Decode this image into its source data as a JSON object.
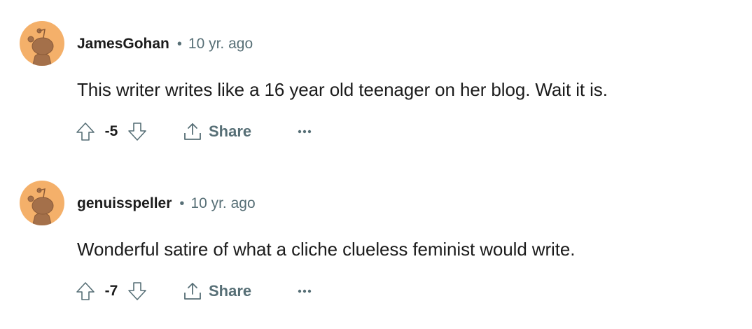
{
  "comments": [
    {
      "author": "JamesGohan",
      "separator": "•",
      "time": "10 yr. ago",
      "text": "This writer writes like a 16 year old teenager on her blog. Wait it is.",
      "score": "-5",
      "share_label": "Share",
      "more_label": "..."
    },
    {
      "author": "genuisspeller",
      "separator": "•",
      "time": "10 yr. ago",
      "text": "Wonderful satire of what a cliche clueless feminist would write.",
      "score": "-7",
      "share_label": "Share",
      "more_label": "..."
    }
  ],
  "colors": {
    "avatar_bg": "#f4b06a",
    "avatar_figure": "#a4704a",
    "muted": "#576f76",
    "text": "#1c1c1c"
  },
  "icons": {
    "avatar": "snoo-avatar-icon",
    "upvote": "upvote-arrow-icon",
    "downvote": "downvote-arrow-icon",
    "share": "share-icon",
    "more": "overflow-dots-icon"
  }
}
